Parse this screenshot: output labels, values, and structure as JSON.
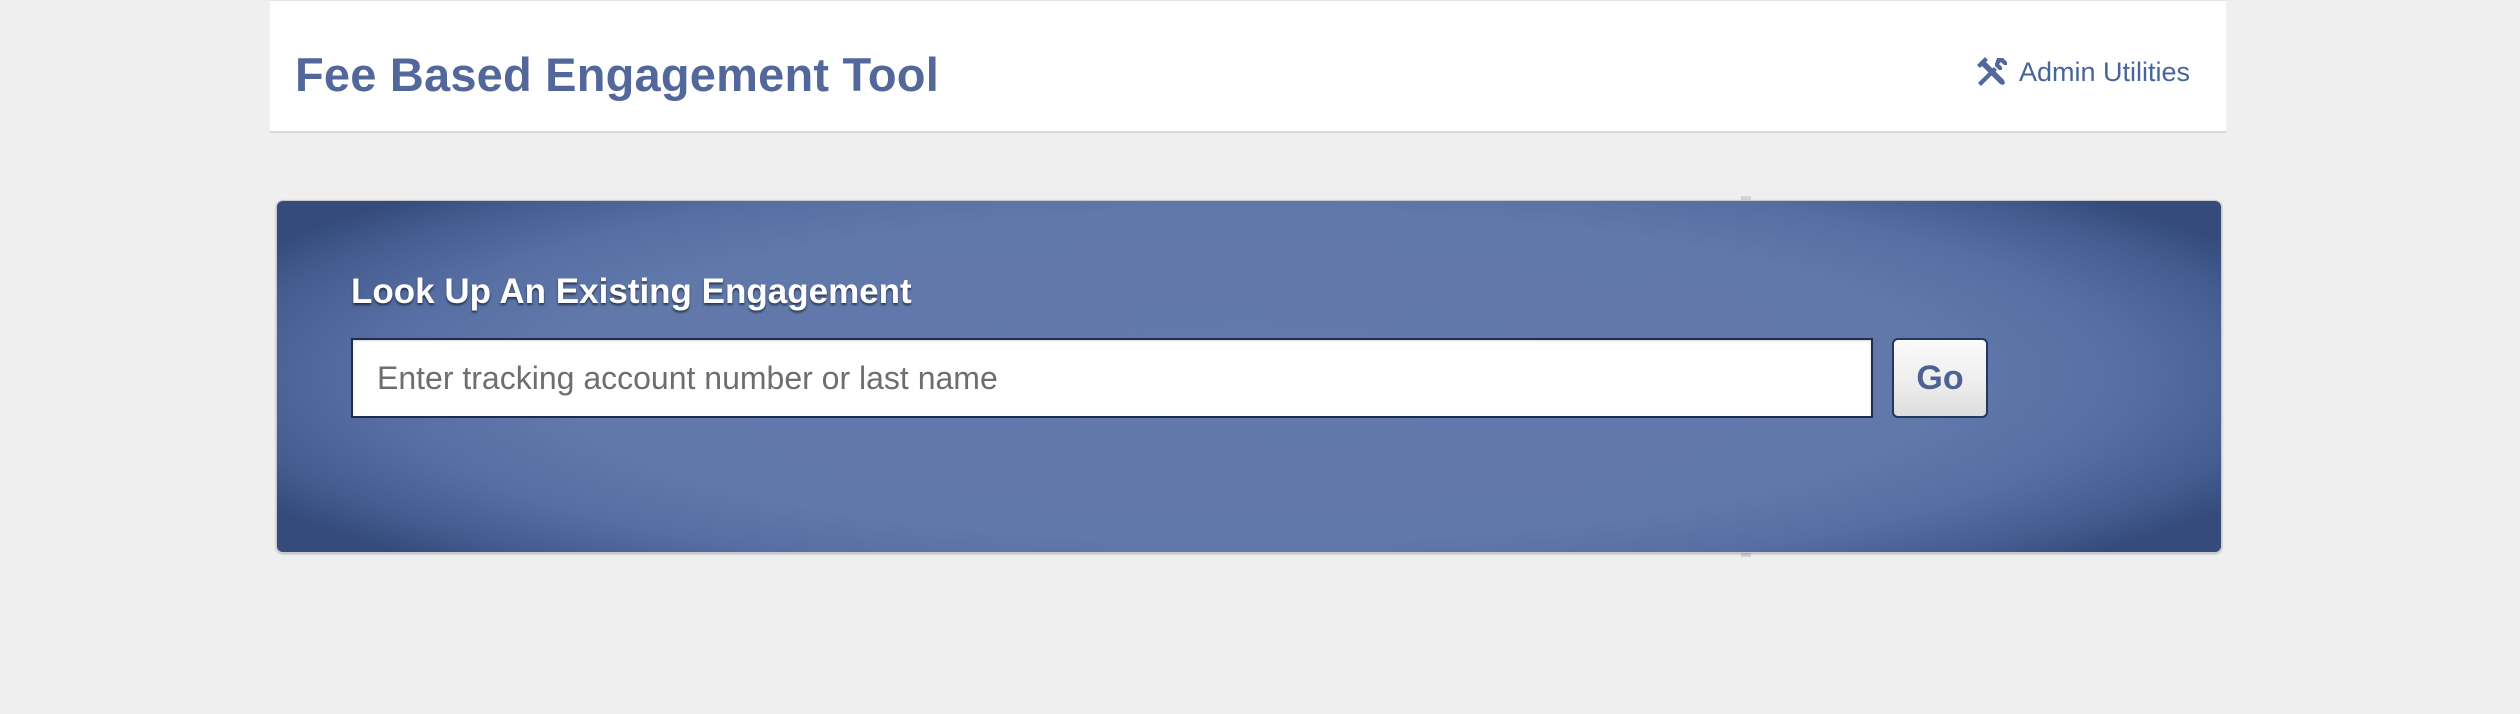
{
  "header": {
    "title": "Fee Based Engagement Tool",
    "admin_link": {
      "label": "Admin Utilities",
      "icon": "tools-icon"
    }
  },
  "lookup": {
    "heading": "Look Up An Existing Engagement",
    "search": {
      "value": "",
      "placeholder": "Enter tracking account number or last name"
    },
    "go_label": "Go"
  },
  "colors": {
    "page_background": "#efefef",
    "header_background": "#ffffff",
    "title_blue": "#52679a",
    "link_blue": "#48649c",
    "panel_blue": "#6178ab",
    "panel_edge": "#344b7b"
  }
}
